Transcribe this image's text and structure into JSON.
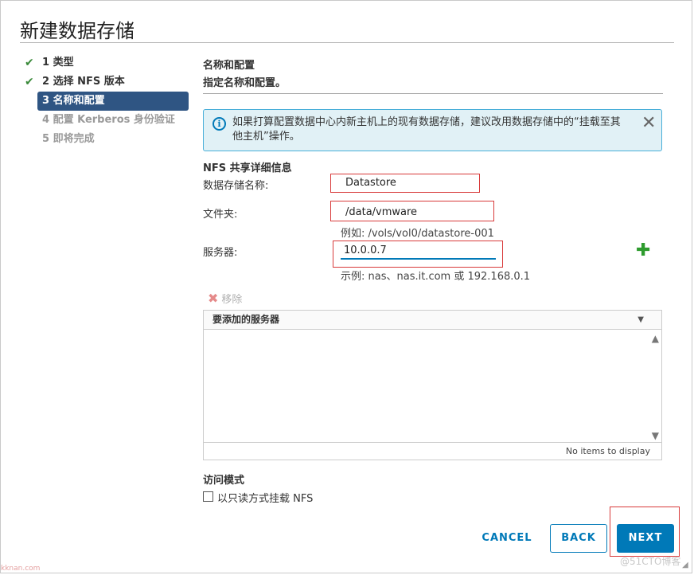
{
  "dialog": {
    "title": "新建数据存储"
  },
  "steps": [
    {
      "label": "1 类型",
      "state": "done"
    },
    {
      "label": "2 选择 NFS 版本",
      "state": "done"
    },
    {
      "label": "3 名称和配置",
      "state": "active"
    },
    {
      "label": "4 配置 Kerberos 身份验证",
      "state": "disabled"
    },
    {
      "label": "5 即将完成",
      "state": "disabled"
    }
  ],
  "section": {
    "title": "名称和配置",
    "subtitle": "指定名称和配置。"
  },
  "info_banner": {
    "icon": "info-icon",
    "text": "如果打算配置数据中心内新主机上的现有数据存储，建议改用数据存储中的“挂载至其他主机”操作。",
    "close_icon": "close-icon"
  },
  "nfs": {
    "group_title": "NFS 共享详细信息",
    "name_label": "数据存储名称:",
    "name_value": "Datastore",
    "folder_label": "文件夹:",
    "folder_value": "/data/vmware",
    "folder_hint": "例如: /vols/vol0/datastore-001",
    "server_label": "服务器:",
    "server_value": "10.0.0.7",
    "server_hint": "示例: nas、nas.it.com 或 192.168.0.1",
    "add_icon": "plus-icon"
  },
  "servers_grid": {
    "remove_label": "移除",
    "header": "要添加的服务器",
    "empty_text": "No items to display"
  },
  "access": {
    "title": "访问模式",
    "readonly_label": "以只读方式挂载 NFS",
    "readonly_checked": false
  },
  "buttons": {
    "cancel": "CANCEL",
    "back": "BACK",
    "next": "NEXT"
  },
  "watermarks": {
    "left": "kknan.com",
    "right": "@51CTO博客"
  },
  "colors": {
    "primary": "#0079b8",
    "active_step": "#2f5583",
    "highlight_box": "#d83a3a",
    "success": "#3a8a3a"
  }
}
